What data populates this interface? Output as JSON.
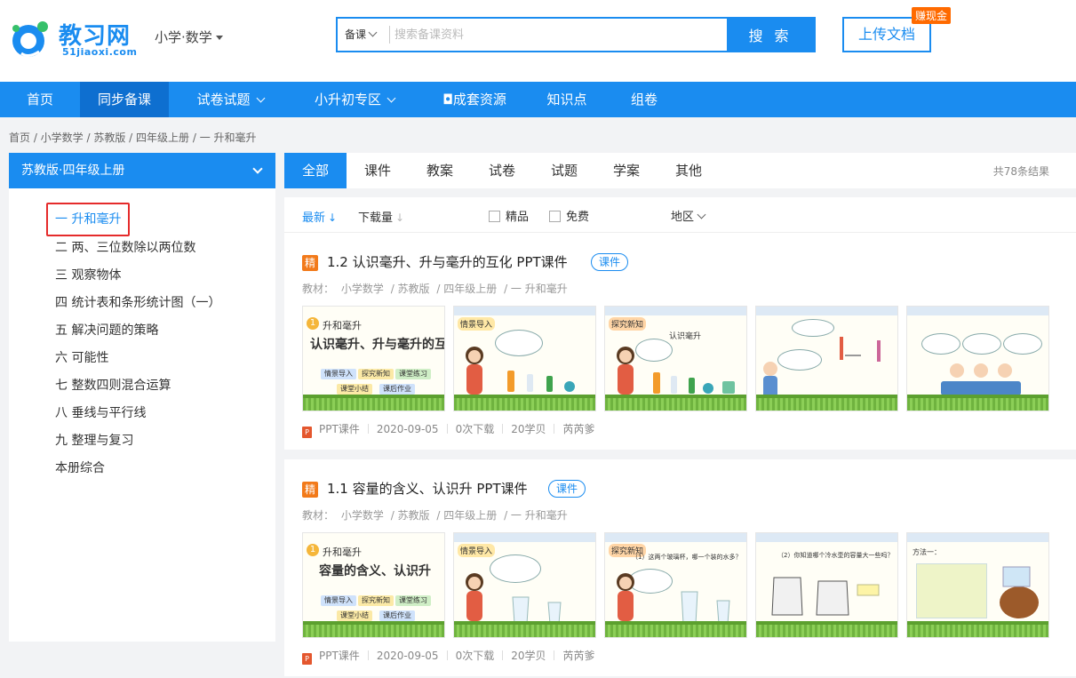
{
  "header": {
    "logo_text": "教习网",
    "logo_sub": "51jiaoxi.com",
    "subject": "小学·数学",
    "search": {
      "category": "备课",
      "placeholder": "搜索备课资料",
      "button": "搜 索"
    },
    "upload_label": "上传文档",
    "earn_badge": "赚现金"
  },
  "nav": {
    "items": [
      {
        "label": "首页"
      },
      {
        "label": "同步备课"
      },
      {
        "label": "试卷试题"
      },
      {
        "label": "小升初专区"
      },
      {
        "label": "◘成套资源"
      },
      {
        "label": "知识点"
      },
      {
        "label": "组卷"
      }
    ]
  },
  "breadcrumb": "首页 / 小学数学 / 苏教版 / 四年级上册 / 一 升和毫升",
  "sidebar": {
    "title": "苏教版·四年级上册",
    "chapters": [
      "一 升和毫升",
      "二 两、三位数除以两位数",
      "三 观察物体",
      "四 统计表和条形统计图（一）",
      "五 解决问题的策略",
      "六 可能性",
      "七 整数四则混合运算",
      "八 垂线与平行线",
      "九 整理与复习",
      "本册综合"
    ]
  },
  "tabs": {
    "items": [
      "全部",
      "课件",
      "教案",
      "试卷",
      "试题",
      "学案",
      "其他"
    ],
    "total": "共78条结果"
  },
  "filter": {
    "newest": "最新",
    "downloads": "下载量",
    "premium": "精品",
    "free": "免费",
    "region": "地区"
  },
  "results": [
    {
      "badge": "精",
      "title": "1.2 认识毫升、升与毫升的互化 PPT课件",
      "kind": "课件",
      "meta": [
        "教材：",
        "小学数学",
        "/ 苏教版",
        "/ 四年级上册",
        "/ 一 升和毫升"
      ],
      "slides": {
        "s1_unit": "升和毫升",
        "s1_title": "认识毫升、升与毫升的互化",
        "chips": [
          "情景导入",
          "探究新知",
          "课堂练习",
          "课堂小结",
          "课后作业"
        ],
        "s2_label": "情景导入",
        "s3_label": "探究新知",
        "s3_note": "认识毫升"
      },
      "footer": {
        "type": "PPT课件",
        "date": "2020-09-05",
        "downloads": "0次下载",
        "price": "20学贝",
        "author": "芮芮爹"
      }
    },
    {
      "badge": "精",
      "title": "1.1 容量的含义、认识升 PPT课件",
      "kind": "课件",
      "meta": [
        "教材：",
        "小学数学",
        "/ 苏教版",
        "/ 四年级上册",
        "/ 一 升和毫升"
      ],
      "slides": {
        "s1_unit": "升和毫升",
        "s1_title": "容量的含义、认识升",
        "chips": [
          "情景导入",
          "探究新知",
          "课堂练习",
          "课堂小结",
          "课后作业"
        ],
        "s2_label": "情景导入",
        "s3_label": "探究新知",
        "s3_note": "（1）这两个玻璃杯，哪一个装的水多？",
        "s4_note": "（2）你知道哪个冷水壶的容量大一些吗？",
        "s5_note": "方法一："
      },
      "footer": {
        "type": "PPT课件",
        "date": "2020-09-05",
        "downloads": "0次下载",
        "price": "20学贝",
        "author": "芮芮爹"
      }
    }
  ],
  "colors": {
    "brand": "#1a8cf0",
    "nav_active": "#0e6fd0",
    "highlight_border": "#e52b2b",
    "badge": "#f27a1a",
    "earn": "#ff6a00"
  }
}
